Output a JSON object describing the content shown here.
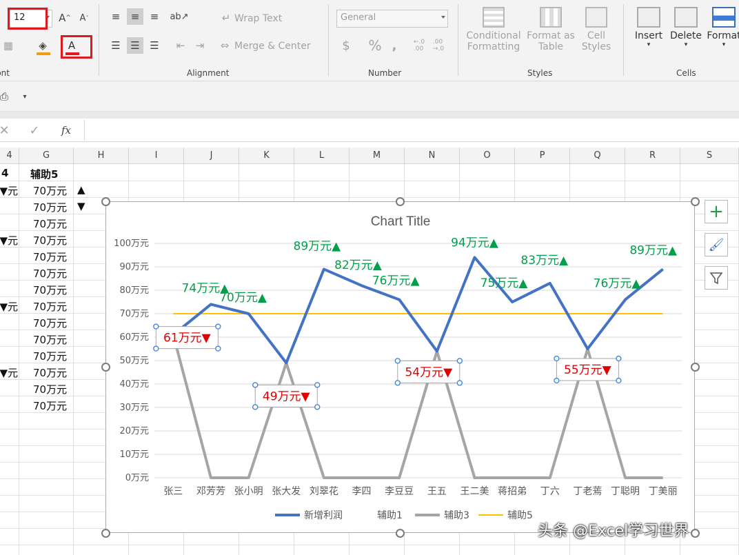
{
  "ribbon": {
    "font_size": "12",
    "font_group_label": "Font",
    "alignment_label": "Alignment",
    "number_label": "Number",
    "styles_label": "Styles",
    "cells_label": "Cells",
    "wrap_text": "Wrap Text",
    "merge_center": "Merge & Center",
    "number_format": "General",
    "conditional_formatting_1": "Conditional",
    "conditional_formatting_2": "Formatting",
    "format_as_table_1": "Format as",
    "format_as_table_2": "Table",
    "cell_styles_1": "Cell",
    "cell_styles_2": "Styles",
    "insert": "Insert",
    "delete": "Delete",
    "format": "Format",
    "font_color": "#e0191f",
    "fill_color": "#f39c12"
  },
  "formula": {
    "fx": "fx",
    "content": ""
  },
  "columns": [
    "4",
    "G",
    "H",
    "I",
    "J",
    "K",
    "L",
    "M",
    "N",
    "O",
    "P",
    "Q",
    "R",
    "S"
  ],
  "sheet": {
    "g_header": "辅助5",
    "f_header": "4",
    "g_values": [
      "70万元",
      "70万元",
      "70万元",
      "70万元",
      "70万元",
      "70万元",
      "70万元",
      "70万元",
      "70万元",
      "70万元",
      "70万元",
      "70万元",
      "70万元",
      "70万元"
    ],
    "h_values": [
      "▲",
      "▼"
    ],
    "f_values": [
      "元▼",
      "",
      "",
      "元▼",
      "",
      "",
      "",
      "元▼",
      "",
      "",
      "",
      "元▼",
      "",
      ""
    ]
  },
  "chart_data": {
    "type": "line",
    "title": "Chart Title",
    "categories": [
      "张三",
      "邓芳芳",
      "张小明",
      "张大发",
      "刘翠花",
      "李四",
      "李豆豆",
      "王五",
      "王二美",
      "蒋招弟",
      "丁六",
      "丁老蔫",
      "丁聪明",
      "丁美丽"
    ],
    "y_ticks": [
      "0万元",
      "10万元",
      "20万元",
      "30万元",
      "40万元",
      "50万元",
      "60万元",
      "70万元",
      "80万元",
      "90万元",
      "100万元"
    ],
    "ylim": [
      0,
      100
    ],
    "series": [
      {
        "name": "新增利润",
        "color": "#4472c4",
        "values": [
          61,
          74,
          70,
          49,
          89,
          82,
          76,
          54,
          94,
          75,
          83,
          55,
          76,
          89
        ]
      },
      {
        "name": "辅助3",
        "color": "#a5a5a5",
        "values": [
          61,
          0,
          0,
          49,
          0,
          0,
          0,
          54,
          0,
          0,
          0,
          55,
          0,
          0
        ]
      },
      {
        "name": "辅助5",
        "color": "#ffc000",
        "values": [
          70,
          70,
          70,
          70,
          70,
          70,
          70,
          70,
          70,
          70,
          70,
          70,
          70,
          70
        ]
      }
    ],
    "legend": [
      "新增利润",
      "辅助1",
      "辅助3",
      "辅助5"
    ],
    "up_labels": [
      "74万元▲",
      "70万元▲",
      "89万元▲",
      "82万元▲",
      "76万元▲",
      "94万元▲",
      "75万元▲",
      "83万元▲",
      "76万元▲",
      "89万元▲"
    ],
    "down_labels": [
      "61万元▼",
      "49万元▼",
      "54万元▼",
      "55万元▼"
    ],
    "up_color": "#00a04a",
    "down_color": "#e00000"
  },
  "watermark": "头条 @Excel学习世界"
}
